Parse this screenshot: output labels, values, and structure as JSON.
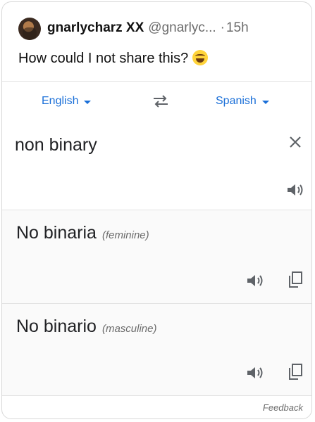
{
  "tweet": {
    "display_name": "gnarlycharz XX",
    "handle": "@gnarlyc...",
    "separator": "·",
    "time": "15h",
    "text": "How could I not share this?"
  },
  "translator": {
    "source_language": "English",
    "target_language": "Spanish",
    "source_text": "non binary",
    "results": [
      {
        "text": "No binaria",
        "gender": "(feminine)"
      },
      {
        "text": "No binario",
        "gender": "(masculine)"
      }
    ],
    "feedback_label": "Feedback"
  },
  "colors": {
    "accent": "#1a6fd8",
    "icon_gray": "#5f6368",
    "muted_text": "#6b6b6b"
  },
  "icons": [
    "avatar",
    "face-with-tears-of-joy-emoji",
    "caret-down-icon",
    "swap-languages-icon",
    "close-icon",
    "speaker-icon",
    "copy-icon"
  ]
}
